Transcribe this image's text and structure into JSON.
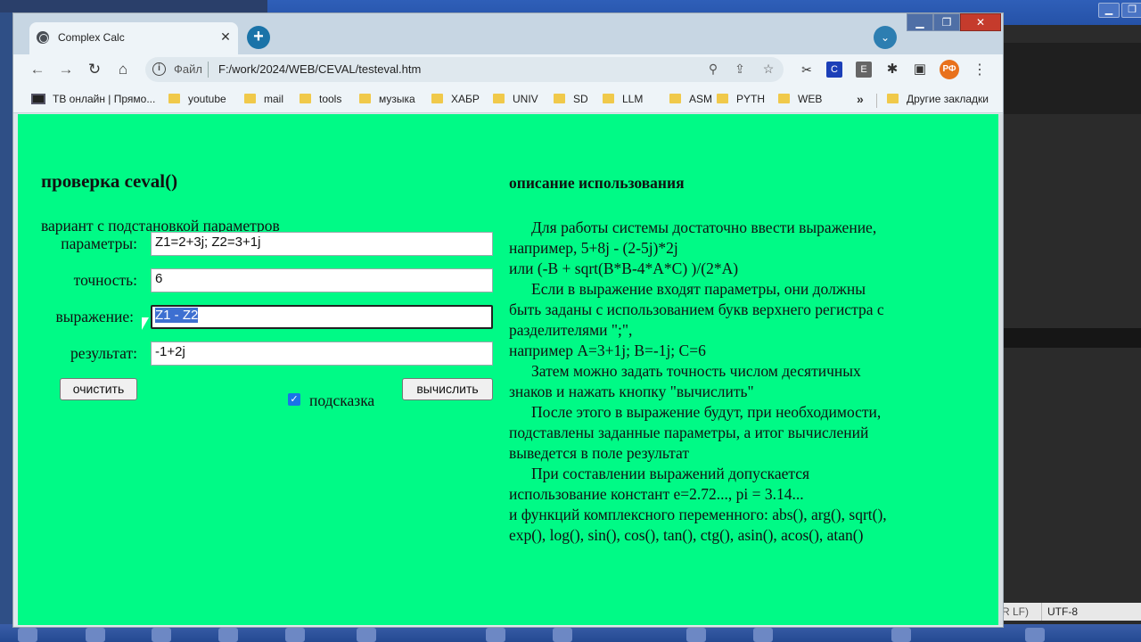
{
  "browser": {
    "tab_title": "Complex Calc",
    "url_scheme": "Файл",
    "url": "F:/work/2024/WEB/CEVAL/testeval.htm",
    "profile_initials": "РФ",
    "ext_c": "C",
    "ext_e": "E",
    "bookmarks": [
      {
        "label": "ТВ онлайн | Прямо..."
      },
      {
        "label": "youtube"
      },
      {
        "label": "mail"
      },
      {
        "label": "tools"
      },
      {
        "label": "музыка"
      },
      {
        "label": "ХАБР"
      },
      {
        "label": "UNIV"
      },
      {
        "label": "SD"
      },
      {
        "label": "LLM"
      },
      {
        "label": "ASM"
      },
      {
        "label": "PYTH"
      },
      {
        "label": "WEB"
      }
    ],
    "other_bookmarks": "Другие закладки",
    "colors": {
      "page_bg": "#00fa86",
      "accent": "#1a73a8"
    }
  },
  "page": {
    "title": "проверка ceval()",
    "variant": "вариант с подстановкой параметров",
    "fields": {
      "params_label": "параметры:",
      "params_value": "Z1=2+3j; Z2=3+1j",
      "precision_label": "точность:",
      "precision_value": "6",
      "expr_label": "выражение:",
      "expr_value": "Z1 - Z2",
      "result_label": "результат:",
      "result_value": "-1+2j"
    },
    "clear_button": "очистить",
    "hint_label": "подсказка",
    "hint_checked": true,
    "calc_button": "вычислить",
    "desc_title": "описание использования",
    "desc": {
      "l1": "Для работы системы достаточно ввести выражение,",
      "l2": "например, 5+8j - (2-5j)*2j",
      "l3": "или (-B + sqrt(B*B-4*A*C) )/(2*A)",
      "l4": "Если в выражение входят параметры, они должны",
      "l5": "быть заданы с использованием букв верхнего регистра с",
      "l6": "разделителями \";\",",
      "l7": "например A=3+1j; B=-1j; C=6",
      "l8": "Затем можно задать точность числом десятичных",
      "l9": "знаков и нажать кнопку \"вычислить\"",
      "l10": "После этого в выражение будут, при необходимости,",
      "l11": "подставлены заданные параметры, а итог вычислений",
      "l12": "выведется в поле результат",
      "l13": "При составлении выражений допускается",
      "l14": "использование констант e=2.72..., pi = 3.14...",
      "l15": "и функций комплексного переменного: abs(), arg(), sqrt(),",
      "l16": "exp(), log(), sin(), cos(), tan(), ctg(), asin(), acos(), atan()"
    }
  },
  "desktop": {
    "status_encoding": "UTF-8",
    "status_crlf": "R LF)"
  }
}
